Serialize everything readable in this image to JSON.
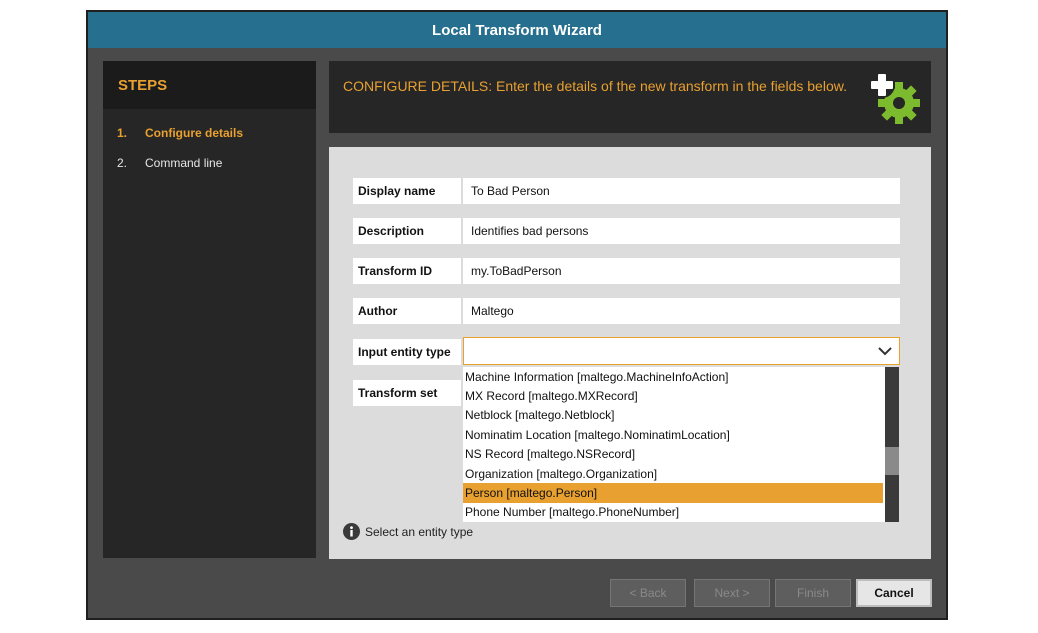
{
  "window": {
    "title": "Local Transform Wizard"
  },
  "steps": {
    "header": "STEPS",
    "items": [
      {
        "num": "1.",
        "label": "Configure details"
      },
      {
        "num": "2.",
        "label": "Command line"
      }
    ]
  },
  "details_header": {
    "text": "CONFIGURE DETAILS: Enter the details of the new transform in the fields below."
  },
  "form": {
    "display_name": {
      "label": "Display name",
      "value": "To Bad Person"
    },
    "description": {
      "label": "Description",
      "value": "Identifies bad persons"
    },
    "transform_id": {
      "label": "Transform ID",
      "value": "my.ToBadPerson"
    },
    "author": {
      "label": "Author",
      "value": "Maltego"
    },
    "input_entity_type": {
      "label": "Input entity type",
      "value": ""
    },
    "transform_set": {
      "label": "Transform set"
    }
  },
  "dropdown": {
    "options": [
      "Machine Information [maltego.MachineInfoAction]",
      "MX Record [maltego.MXRecord]",
      "Netblock [maltego.Netblock]",
      "Nominatim Location [maltego.NominatimLocation]",
      "NS Record [maltego.NSRecord]",
      "Organization [maltego.Organization]",
      "Person [maltego.Person]",
      "Phone Number [maltego.PhoneNumber]"
    ],
    "highlighted": "Person [maltego.Person]"
  },
  "hint": "Select an entity type",
  "buttons": {
    "back": "< Back",
    "next": "Next >",
    "finish": "Finish",
    "cancel": "Cancel"
  },
  "colors": {
    "accent": "#e8a030",
    "titlebar": "#266f8e",
    "gear": "#7dbb2e"
  },
  "icons": [
    "plus-gear-icon",
    "chevron-down-icon",
    "info-icon"
  ]
}
